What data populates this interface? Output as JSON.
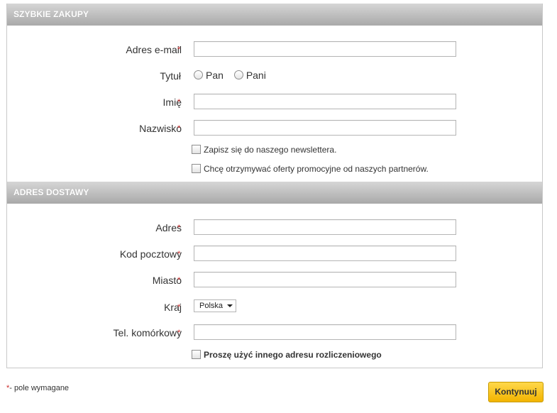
{
  "quick_shopping": {
    "header": "SZYBKIE ZAKUPY",
    "email_label": "Adres e-mail",
    "title_label": "Tytuł",
    "title_options": [
      "Pan",
      "Pani"
    ],
    "first_name_label": "Imię",
    "last_name_label": "Nazwisko",
    "newsletter_label": "Zapisz się do naszego newslettera.",
    "partners_label": "Chcę otrzymywać oferty promocyjne od naszych partnerów."
  },
  "delivery": {
    "header": "ADRES DOSTAWY",
    "address_label": "Adres",
    "postcode_label": "Kod pocztowy",
    "city_label": "Miasto",
    "country_label": "Kraj",
    "country_value": "Polska",
    "phone_label": "Tel. komórkowy",
    "billing_label": "Proszę użyć innego adresu rozliczeniowego"
  },
  "required_mark": "*",
  "footnote_text": "- pole wymagane",
  "continue_button": "Kontynuuj"
}
